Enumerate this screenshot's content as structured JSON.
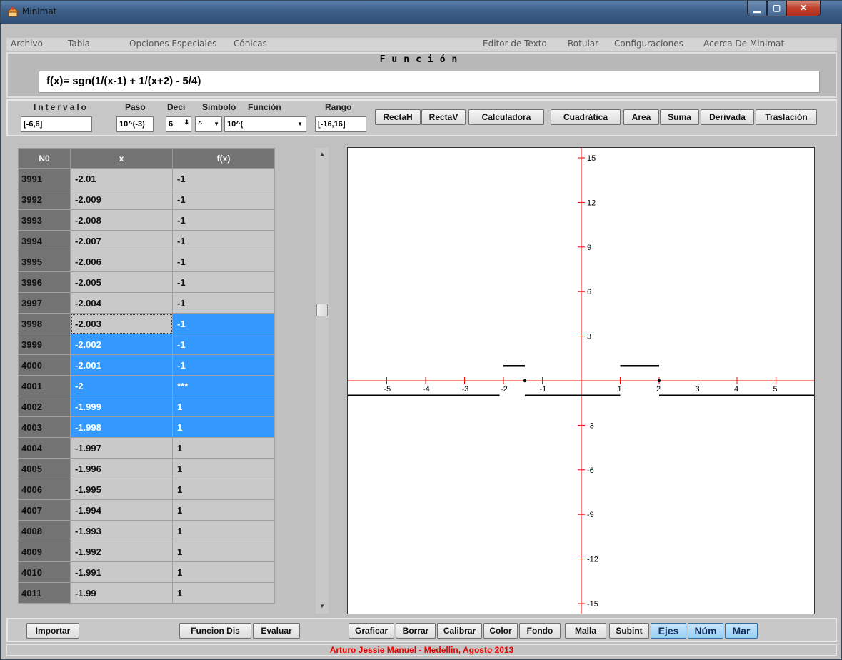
{
  "window": {
    "title": "Minimat"
  },
  "menu": {
    "left": [
      "Archivo",
      "Tabla",
      "Opciones Especiales",
      "Cónicas"
    ],
    "right": [
      "Editor de Texto",
      "Rotular",
      "Configuraciones",
      "Acerca De Minimat"
    ]
  },
  "funcion": {
    "title": "Función",
    "expression": "f(x)= sgn(1/(x-1) + 1/(x+2) - 5/4)"
  },
  "controls": {
    "intervalo_label": "Intervalo",
    "intervalo_value": "[-6,6]",
    "paso_label": "Paso",
    "paso_value": "10^(-3)",
    "deci_label": "Deci",
    "deci_value": "6",
    "simbolo_label": "Simbolo",
    "simbolo_value": "^",
    "funcion_label": "Función",
    "funcion_value": "10^(",
    "rango_label": "Rango",
    "rango_value": "[-16,16]"
  },
  "tool_buttons": [
    "RectaH",
    "RectaV",
    "Calculadora",
    "Cuadrática",
    "Area",
    "Suma",
    "Derivada",
    "Traslación"
  ],
  "table": {
    "headers": [
      "N0",
      "x",
      "f(x)"
    ],
    "rows": [
      {
        "n": "3991",
        "x": "-2.01",
        "f": "-1",
        "sel": false
      },
      {
        "n": "3992",
        "x": "-2.009",
        "f": "-1",
        "sel": false
      },
      {
        "n": "3993",
        "x": "-2.008",
        "f": "-1",
        "sel": false
      },
      {
        "n": "3994",
        "x": "-2.007",
        "f": "-1",
        "sel": false
      },
      {
        "n": "3995",
        "x": "-2.006",
        "f": "-1",
        "sel": false
      },
      {
        "n": "3996",
        "x": "-2.005",
        "f": "-1",
        "sel": false
      },
      {
        "n": "3997",
        "x": "-2.004",
        "f": "-1",
        "sel": false
      },
      {
        "n": "3998",
        "x": "-2.003",
        "f": "-1",
        "sel": true,
        "focus": true
      },
      {
        "n": "3999",
        "x": "-2.002",
        "f": "-1",
        "sel": true
      },
      {
        "n": "4000",
        "x": "-2.001",
        "f": "-1",
        "sel": true
      },
      {
        "n": "4001",
        "x": "-2",
        "f": "***",
        "sel": true
      },
      {
        "n": "4002",
        "x": "-1.999",
        "f": "1",
        "sel": true
      },
      {
        "n": "4003",
        "x": "-1.998",
        "f": "1",
        "sel": true
      },
      {
        "n": "4004",
        "x": "-1.997",
        "f": "1",
        "sel": false
      },
      {
        "n": "4005",
        "x": "-1.996",
        "f": "1",
        "sel": false
      },
      {
        "n": "4006",
        "x": "-1.995",
        "f": "1",
        "sel": false
      },
      {
        "n": "4007",
        "x": "-1.994",
        "f": "1",
        "sel": false
      },
      {
        "n": "4008",
        "x": "-1.993",
        "f": "1",
        "sel": false
      },
      {
        "n": "4009",
        "x": "-1.992",
        "f": "1",
        "sel": false
      },
      {
        "n": "4010",
        "x": "-1.991",
        "f": "1",
        "sel": false
      },
      {
        "n": "4011",
        "x": "-1.99",
        "f": "1",
        "sel": false
      }
    ]
  },
  "graph": {
    "x_ticks": [
      "-5",
      "-4",
      "-3",
      "-2",
      "-1",
      "1",
      "2",
      "3",
      "4",
      "5"
    ],
    "y_ticks": [
      "15",
      "12",
      "9",
      "6",
      "3",
      "-3",
      "-6",
      "-9",
      "-12",
      "-15"
    ],
    "xlim": [
      -6,
      6
    ],
    "ylim": [
      -16,
      16
    ],
    "axis_color": "#ff0000",
    "curve_color": "#000000",
    "segments": [
      {
        "x0": -6,
        "x1": -2.1,
        "y": -1
      },
      {
        "x0": -2.0,
        "x1": -1.45,
        "y": 1
      },
      {
        "x0": -1.45,
        "x1": 1.0,
        "y": -1
      },
      {
        "x0": 1.0,
        "x1": 2.0,
        "y": 1
      },
      {
        "x0": 2.0,
        "x1": 6,
        "y": -1
      }
    ],
    "points": [
      {
        "x": -1.45,
        "y": 0
      },
      {
        "x": 2.0,
        "y": 0
      }
    ]
  },
  "bottom": {
    "importar": "Importar",
    "funcion_dis": "Funcion Dis",
    "evaluar": "Evaluar",
    "graph_buttons": [
      "Graficar",
      "Borrar",
      "Calibrar",
      "Color",
      "Fondo",
      "Malla",
      "Subint"
    ],
    "toggle_buttons": [
      "Ejes",
      "Núm",
      "Mar"
    ]
  },
  "status": "Arturo Jessie Manuel - Medellin, Agosto 2013"
}
